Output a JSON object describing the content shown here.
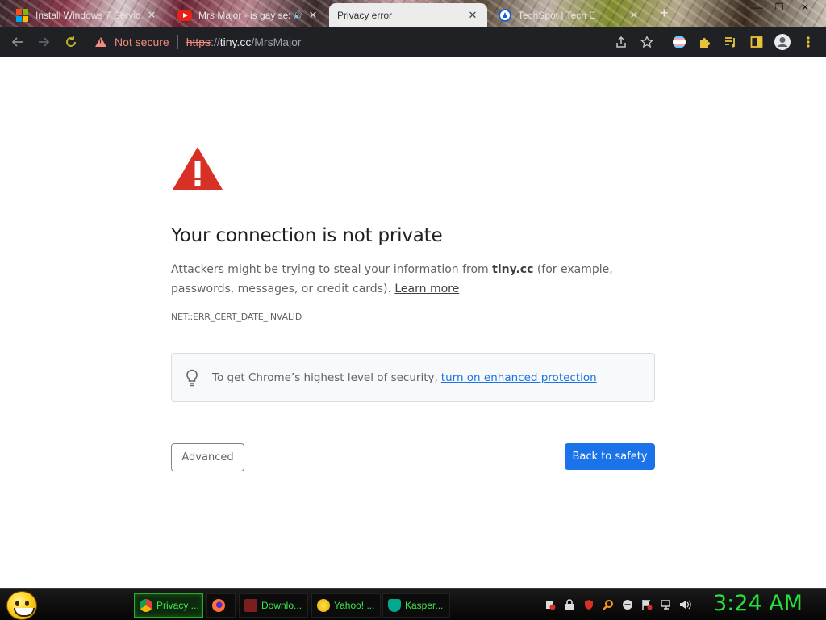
{
  "tabs": [
    {
      "title": "Install Windows 7 Servic",
      "close": "✕",
      "icon": "microsoft-logo"
    },
    {
      "title": "Mrs Major - is gay sex",
      "close": "✕",
      "icon": "youtube-logo",
      "audio": "🔊"
    },
    {
      "title": "Privacy error",
      "close": "✕",
      "icon": "none"
    },
    {
      "title": "TechSpot | Tech E",
      "close": "✕",
      "icon": "techspot-logo"
    }
  ],
  "new_tab": "+",
  "window_controls": {
    "minimize": "—",
    "maximize": "❐",
    "close": "✕"
  },
  "toolbar": {
    "security_label": "Not secure",
    "url_scheme": "https",
    "url_sep": "://",
    "url_host": "tiny.cc",
    "url_path": "/MrsMajor"
  },
  "page": {
    "heading": "Your connection is not private",
    "desc_part1": "Attackers might be trying to steal your information from ",
    "desc_host": "tiny.cc",
    "desc_part2": " (for example, passwords, messages, or credit cards). ",
    "learn_more": "Learn more",
    "error_code": "NET::ERR_CERT_DATE_INVALID",
    "enhanced_text": "To get Chrome’s highest level of security, ",
    "enhanced_link": "turn on enhanced protection",
    "advanced_label": "Advanced",
    "back_label": "Back to safety"
  },
  "taskbar": {
    "tasks": [
      {
        "label": "Privacy ...",
        "icon": "chrome-icon",
        "color": "#4285f4"
      },
      {
        "label": "",
        "icon": "firefox-icon",
        "color": "#ff7139"
      },
      {
        "label": "Downlo...",
        "icon": "download-icon",
        "color": "#d93025"
      },
      {
        "label": "Yahoo! ...",
        "icon": "yahoo-smiley-icon",
        "color": "#ffcc00"
      },
      {
        "label": "Kasper...",
        "icon": "kaspersky-icon",
        "color": "#00a88e"
      }
    ],
    "clock": "3:24 AM"
  },
  "colors": {
    "chrome_dark": "#202124",
    "danger_red": "#d93025",
    "link_blue": "#1a73e8",
    "primary_button": "#1a73e8",
    "taskbar_green": "#3ce64b"
  }
}
